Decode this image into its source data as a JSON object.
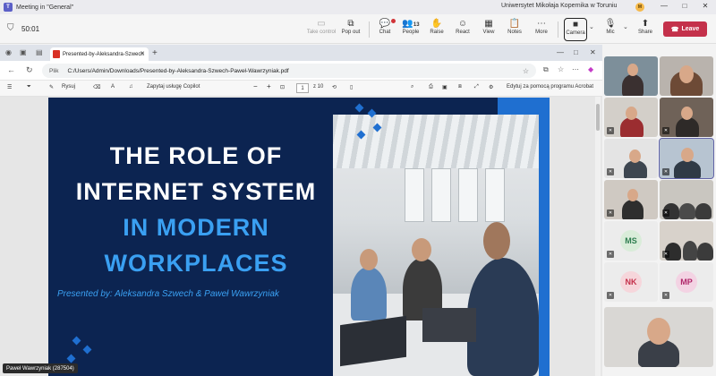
{
  "window": {
    "title": "Meeting in \"General\"",
    "org": "Uniwersytet Mikołaja Kopernika w Toruniu",
    "org_avatar": "M",
    "controls": [
      "—",
      "□",
      "✕"
    ]
  },
  "meeting": {
    "timer": "50:01",
    "tools": [
      {
        "id": "take-control",
        "label": "Take control",
        "icon": "take-control-icon",
        "glyph": "▭",
        "disabled": true
      },
      {
        "id": "pop-out",
        "label": "Pop out",
        "icon": "pop-out-icon",
        "glyph": "⧉"
      },
      {
        "id": "chat",
        "label": "Chat",
        "icon": "chat-icon",
        "glyph": "💬"
      },
      {
        "id": "people",
        "label": "People",
        "icon": "people-icon",
        "glyph": "👥",
        "count": "13"
      },
      {
        "id": "raise",
        "label": "Raise",
        "icon": "raise-hand-icon",
        "glyph": "✋"
      },
      {
        "id": "react",
        "label": "React",
        "icon": "react-icon",
        "glyph": "☺"
      },
      {
        "id": "view",
        "label": "View",
        "icon": "view-icon",
        "glyph": "▦"
      },
      {
        "id": "notes",
        "label": "Notes",
        "icon": "notes-icon",
        "glyph": "📋"
      },
      {
        "id": "more",
        "label": "More",
        "icon": "more-icon",
        "glyph": "⋯"
      },
      {
        "id": "camera",
        "label": "Camera",
        "icon": "camera-icon",
        "glyph": "■"
      },
      {
        "id": "mic",
        "label": "Mic",
        "icon": "mic-icon",
        "glyph": "🎙"
      },
      {
        "id": "share",
        "label": "Share",
        "icon": "share-icon",
        "glyph": "⬆"
      }
    ],
    "leave_label": "Leave",
    "brand_color": "#5b5fc7",
    "leave_color": "#c4314b"
  },
  "browser": {
    "tab_title": "Presented-by-Aleksandra-Szwech",
    "url_prefix": "Plik",
    "url": "C:/Users/Admin/Downloads/Presented-by-Aleksandra-Szwech-Paweł-Wawrzyniak.pdf"
  },
  "pdf_toolbar": {
    "draw_label": "Rysuj",
    "copilot_label": "Zapytaj usługę Copilot",
    "page_current": "1",
    "page_total": "z 10",
    "edit_label": "Edytuj za pomocą programu Acrobat",
    "zoom_out": "−",
    "zoom_in": "+"
  },
  "slide": {
    "title_line1": "THE ROLE OF",
    "title_line2": "INTERNET SYSTEM",
    "title_line3": "IN MODERN",
    "title_line4": "WORKPLACES",
    "byline": "Presented by: Aleksandra Szwech & Paweł Wawrzyniak",
    "bg_color": "#0c2451",
    "accent_color": "#1f6fd0",
    "highlight_color": "#3aa0f2"
  },
  "presenter_label": "Paweł Wawrzyniak (287504)",
  "participants": [
    {
      "initials": "MS",
      "color": "#2e7d4f",
      "bg": "#d9ecd9"
    },
    {
      "initials": "NK",
      "color": "#c4314b",
      "bg": "#f6d6db"
    },
    {
      "initials": "MP",
      "color": "#b0276a",
      "bg": "#f3d3e3"
    }
  ]
}
